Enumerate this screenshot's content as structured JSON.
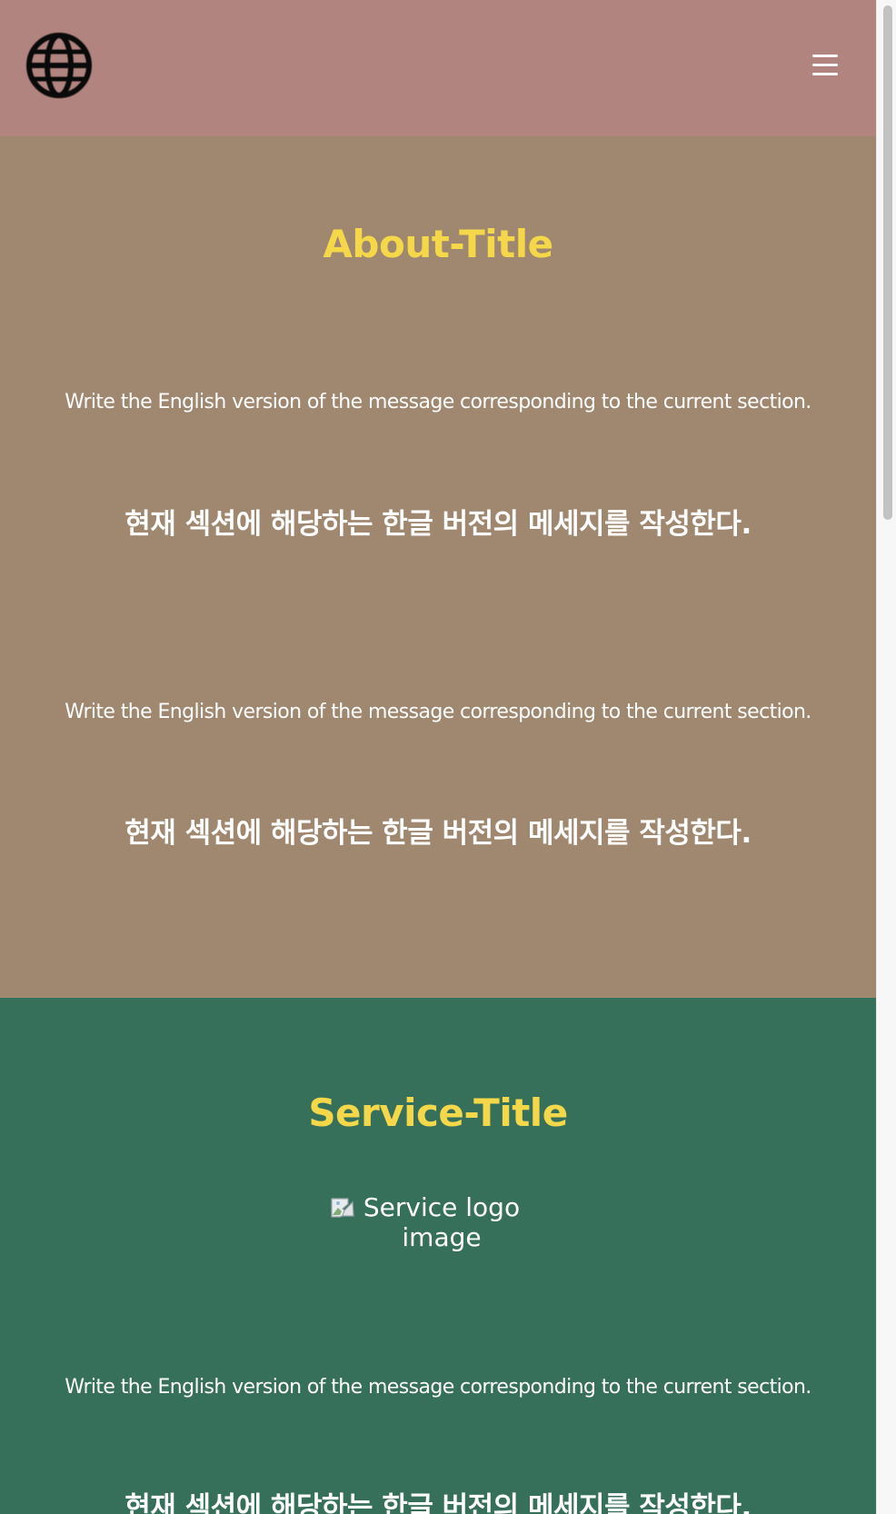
{
  "navbar": {
    "logo_icon": "globe-icon",
    "menu_icon": "hamburger-menu-icon",
    "background_color": "#b1847f"
  },
  "about": {
    "title": "About-Title",
    "background_color": "#a0876f",
    "title_color": "#f5d74a",
    "blocks": [
      {
        "english": "Write the English version of the message corresponding to the current section.",
        "korean": "현재 섹션에 해당하는 한글 버전의 메세지를 작성한다."
      },
      {
        "english": "Write the English version of the message corresponding to the current section.",
        "korean": "현재 섹션에 해당하는 한글 버전의 메세지를 작성한다."
      }
    ]
  },
  "service": {
    "title": "Service-Title",
    "background_color": "#36705b",
    "logo_alt": "Service logo image",
    "logo_icon": "broken-image-icon",
    "english": "Write the English version of the message corresponding to the current section.",
    "korean": "현재 섹션에 해당하는 한글 버전의 메세지를 작성한다."
  }
}
